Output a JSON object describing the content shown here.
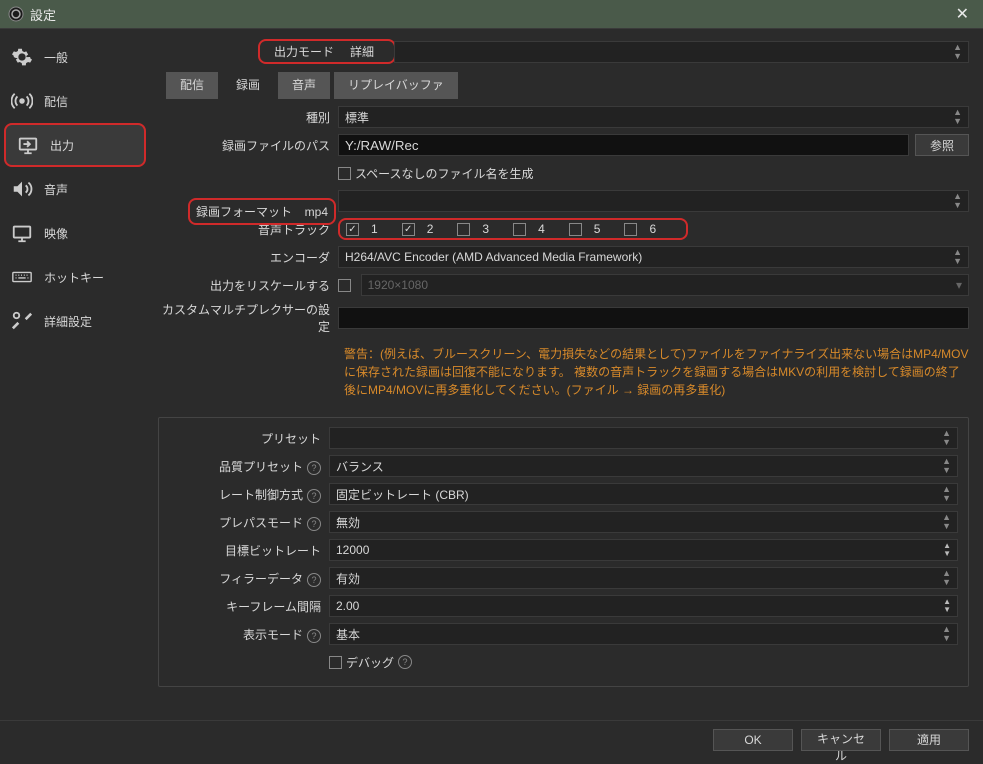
{
  "window": {
    "title": "設定"
  },
  "sidebar": {
    "items": [
      {
        "label": "一般"
      },
      {
        "label": "配信"
      },
      {
        "label": "出力"
      },
      {
        "label": "音声"
      },
      {
        "label": "映像"
      },
      {
        "label": "ホットキー"
      },
      {
        "label": "詳細設定"
      }
    ]
  },
  "outputMode": {
    "label": "出力モード",
    "value": "詳細"
  },
  "tabs": {
    "stream": "配信",
    "recording": "録画",
    "audio": "音声",
    "replay": "リプレイバッファ"
  },
  "recording": {
    "type_label": "種別",
    "type_value": "標準",
    "path_label": "録画ファイルのパス",
    "path_value": "Y:/RAW/Rec",
    "browse": "参照",
    "nospace_label": "スペースなしのファイル名を生成",
    "format_label": "録画フォーマット",
    "format_value": "mp4",
    "tracks_label": "音声トラック",
    "tracks": [
      "1",
      "2",
      "3",
      "4",
      "5",
      "6"
    ],
    "encoder_label": "エンコーダ",
    "encoder_value": "H264/AVC Encoder (AMD Advanced Media Framework)",
    "rescale_label": "出力をリスケールする",
    "rescale_placeholder": "1920×1080",
    "muxer_label": "カスタムマルチプレクサーの設定",
    "warning": "警告：(例えば、ブルースクリーン、電力損失などの結果として)ファイルをファイナライズ出来ない場合はMP4/MOVに保存された録画は回復不能になります。 複数の音声トラックを録画する場合はMKVの利用を検討して録画の終了後にMP4/MOVに再多重化してください。(ファイル → 録画の再多重化)"
  },
  "encoder": {
    "preset_label": "プリセット",
    "preset_value": "",
    "quality_label": "品質プリセット",
    "quality_value": "バランス",
    "rate_label": "レート制御方式",
    "rate_value": "固定ビットレート (CBR)",
    "prepass_label": "プレパスモード",
    "prepass_value": "無効",
    "bitrate_label": "目標ビットレート",
    "bitrate_value": "12000",
    "filler_label": "フィラーデータ",
    "filler_value": "有効",
    "keyframe_label": "キーフレーム間隔",
    "keyframe_value": "2.00",
    "display_label": "表示モード",
    "display_value": "基本",
    "debug_label": "デバッグ"
  },
  "footer": {
    "ok": "OK",
    "cancel": "キャンセル",
    "apply": "適用"
  }
}
